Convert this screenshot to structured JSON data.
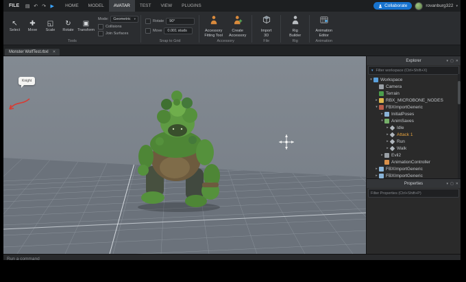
{
  "menubar": {
    "file_label": "FILE",
    "quick_icons": [
      {
        "name": "save-icon",
        "glyph": "▤"
      },
      {
        "name": "undo-icon",
        "glyph": "↶"
      },
      {
        "name": "redo-icon",
        "glyph": "↷"
      },
      {
        "name": "play-icon",
        "glyph": "▶",
        "color": "#3aa4ff"
      }
    ],
    "tabs": [
      {
        "label": "HOME"
      },
      {
        "label": "MODEL"
      },
      {
        "label": "AVATAR",
        "active": true
      },
      {
        "label": "TEST"
      },
      {
        "label": "VIEW"
      },
      {
        "label": "PLUGINS"
      }
    ],
    "collaborate_label": "Collaborate",
    "username": "rovanburg322"
  },
  "icons": {
    "dropdown_glyph": "▾",
    "funnel_glyph": "▼",
    "close_glyph": "✕"
  },
  "panel_icons": [
    "▾",
    "▢",
    "✕"
  ],
  "ribbon": {
    "tools": {
      "label": "Tools",
      "buttons": [
        {
          "label": "Select",
          "glyph": "↖"
        },
        {
          "label": "Move",
          "glyph": "✚"
        },
        {
          "label": "Scale",
          "glyph": "◱"
        },
        {
          "label": "Rotate",
          "glyph": "↻"
        },
        {
          "label": "Transform",
          "glyph": "▣"
        }
      ]
    },
    "mode": {
      "mode_label": "Mode:",
      "mode_value": "Geometric",
      "options": [
        "Collisions",
        "Join Surfaces"
      ]
    },
    "snap": {
      "label": "Snap to Grid",
      "rows": [
        {
          "check": "Rotate",
          "value": "90°"
        },
        {
          "check": "Move",
          "value": "0.001 studs"
        }
      ]
    },
    "big_groups": [
      {
        "label": "Accessory",
        "buttons": [
          {
            "lines": [
              "Accessory",
              "Fitting Tool"
            ],
            "icon": "mannequin"
          },
          {
            "lines": [
              "Create",
              "Accessory"
            ],
            "icon": "mannequin-plus"
          }
        ]
      },
      {
        "label": "File",
        "buttons": [
          {
            "lines": [
              "Import",
              "3D"
            ],
            "icon": "import-cube"
          }
        ]
      },
      {
        "label": "Rig",
        "buttons": [
          {
            "lines": [
              "Rig",
              "Builder"
            ],
            "icon": "rig-person"
          }
        ]
      },
      {
        "label": "Animation",
        "buttons": [
          {
            "lines": [
              "Animation",
              "Editor"
            ],
            "icon": "anim-editor"
          }
        ]
      }
    ]
  },
  "doc_tab": {
    "title": "Monster WolfTest.rbxl"
  },
  "viewport": {
    "note_text": "Knight"
  },
  "explorer": {
    "title": "Explorer",
    "filter_placeholder": "Filter workspace (Ctrl+Shift+X)",
    "tree": [
      {
        "label": "Workspace",
        "depth": 0,
        "arrow": "down",
        "icon": "workspace",
        "color": "#5aa0dc"
      },
      {
        "label": "Camera",
        "depth": 1,
        "arrow": "none",
        "icon": "camera",
        "color": "#9aa0a6"
      },
      {
        "label": "Terrain",
        "depth": 1,
        "arrow": "none",
        "icon": "terrain",
        "color": "#4c9e4c"
      },
      {
        "label": "RBX_MICROBONE_NODES",
        "depth": 1,
        "arrow": "right",
        "icon": "folder",
        "color": "#dcb64e"
      },
      {
        "label": "FBXImportGeneric",
        "depth": 1,
        "arrow": "down",
        "icon": "model",
        "color": "#b85c4a"
      },
      {
        "label": "InitialPoses",
        "depth": 2,
        "arrow": "right",
        "icon": "pose",
        "color": "#8ab4d8"
      },
      {
        "label": "AnimSaves",
        "depth": 2,
        "arrow": "down",
        "icon": "saves",
        "color": "#76b06a"
      },
      {
        "label": "Idle",
        "depth": 3,
        "arrow": "right",
        "icon": "anim",
        "color": "#b0b6bc"
      },
      {
        "label": "Attack 1",
        "depth": 3,
        "arrow": "right",
        "icon": "anim",
        "color": "#b0b6bc",
        "text_color": "#e8a43e"
      },
      {
        "label": "Run",
        "depth": 3,
        "arrow": "right",
        "icon": "anim",
        "color": "#b0b6bc"
      },
      {
        "label": "Walk",
        "depth": 3,
        "arrow": "right",
        "icon": "anim",
        "color": "#b0b6bc"
      },
      {
        "label": "Evil2",
        "depth": 2,
        "arrow": "right",
        "icon": "model",
        "color": "#9aa0a6"
      },
      {
        "label": "AnimationController",
        "depth": 2,
        "arrow": "none",
        "icon": "controller",
        "color": "#d8904a"
      },
      {
        "label": "FBXImportGeneric",
        "depth": 1,
        "arrow": "right",
        "icon": "model",
        "color": "#8ab4d8"
      },
      {
        "label": "FBXImportGeneric",
        "depth": 1,
        "arrow": "right",
        "icon": "model",
        "color": "#8ab4d8"
      }
    ]
  },
  "properties": {
    "title": "Properties",
    "filter_placeholder": "Filter Properties (Ctrl+Shift+P)"
  },
  "command_bar": {
    "placeholder": "Run a command"
  }
}
